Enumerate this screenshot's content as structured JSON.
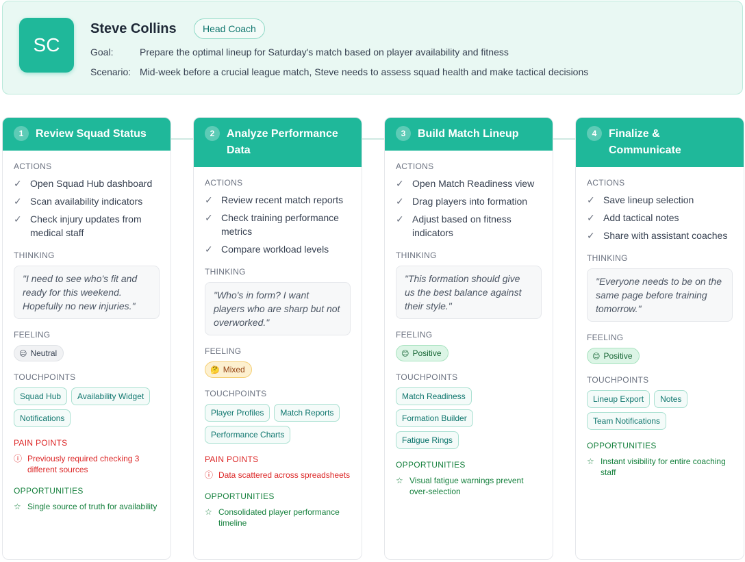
{
  "persona": {
    "initials": "SC",
    "name": "Steve Collins",
    "role": "Head Coach",
    "goal_label": "Goal:",
    "goal": "Prepare the optimal lineup for Saturday's match based on player availability and fitness",
    "scenario_label": "Scenario:",
    "scenario": "Mid-week before a crucial league match, Steve needs to assess squad health and make tactical decisions"
  },
  "labels": {
    "actions": "ACTIONS",
    "thinking": "THINKING",
    "feeling": "FEELING",
    "touchpoints": "TOUCHPOINTS",
    "pain_points": "PAIN POINTS",
    "opportunities": "OPPORTUNITIES"
  },
  "colors": {
    "accent": "#1fb89a",
    "pain": "#dc2626",
    "opportunity": "#15803d"
  },
  "stages": [
    {
      "number": "1",
      "title": "Review Squad Status",
      "actions": [
        "Open Squad Hub dashboard",
        "Scan availability indicators",
        "Check injury updates from medical staff"
      ],
      "thinking": "\"I need to see who's fit and ready for this weekend. Hopefully no new injuries.\"",
      "feeling": {
        "label": "Neutral",
        "icon": "neutral-face-icon",
        "emoji": "😐",
        "tone": "neutral"
      },
      "touchpoints": [
        "Squad Hub",
        "Availability Widget",
        "Notifications"
      ],
      "pain_points": [
        "Previously required checking 3 different sources"
      ],
      "opportunities": [
        "Single source of truth for availability"
      ]
    },
    {
      "number": "2",
      "title": "Analyze Performance Data",
      "actions": [
        "Review recent match reports",
        "Check training performance metrics",
        "Compare workload levels"
      ],
      "thinking": "\"Who's in form? I want players who are sharp but not overworked.\"",
      "feeling": {
        "label": "Mixed",
        "icon": "thinking-face-icon",
        "emoji": "🤔",
        "tone": "mixed"
      },
      "touchpoints": [
        "Player Profiles",
        "Match Reports",
        "Performance Charts"
      ],
      "pain_points": [
        "Data scattered across spreadsheets"
      ],
      "opportunities": [
        "Consolidated player performance timeline"
      ]
    },
    {
      "number": "3",
      "title": "Build Match Lineup",
      "actions": [
        "Open Match Readiness view",
        "Drag players into formation",
        "Adjust based on fitness indicators"
      ],
      "thinking": "\"This formation should give us the best balance against their style.\"",
      "feeling": {
        "label": "Positive",
        "icon": "smiling-face-icon",
        "emoji": "😊",
        "tone": "positive"
      },
      "touchpoints": [
        "Match Readiness",
        "Formation Builder",
        "Fatigue Rings"
      ],
      "pain_points": [],
      "opportunities": [
        "Visual fatigue warnings prevent over-selection"
      ]
    },
    {
      "number": "4",
      "title": "Finalize & Communicate",
      "actions": [
        "Save lineup selection",
        "Add tactical notes",
        "Share with assistant coaches"
      ],
      "thinking": "\"Everyone needs to be on the same page before training tomorrow.\"",
      "feeling": {
        "label": "Positive",
        "icon": "smiling-face-icon",
        "emoji": "😊",
        "tone": "positive"
      },
      "touchpoints": [
        "Lineup Export",
        "Notes",
        "Team Notifications"
      ],
      "pain_points": [],
      "opportunities": [
        "Instant visibility for entire coaching staff"
      ]
    }
  ]
}
